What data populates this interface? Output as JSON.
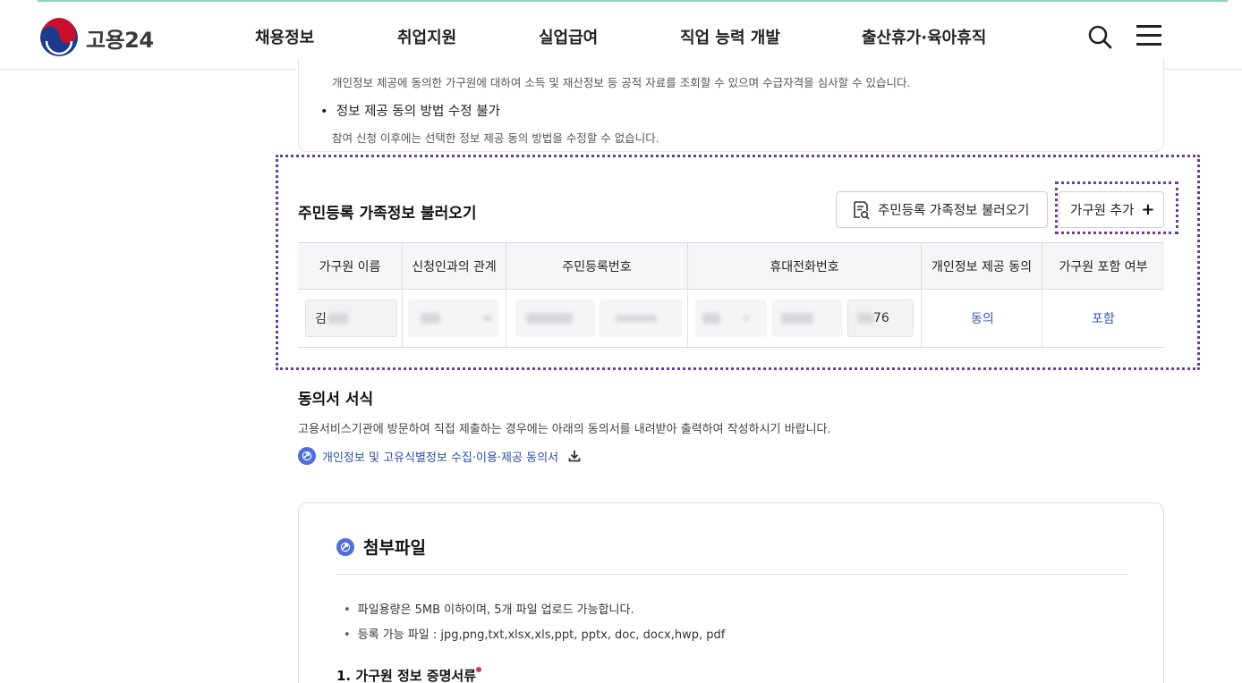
{
  "header": {
    "logo_text": "고용24",
    "nav": [
      "채용정보",
      "취업지원",
      "실업급여",
      "직업 능력 개발",
      "출산휴가·육아휴직"
    ],
    "icons": {
      "search": "search-icon",
      "menu": "hamburger-menu-icon"
    }
  },
  "notice": {
    "line1": "개인정보 제공에 동의한 가구원에 대하여 소득 및 재산정보 등 공적 자료를 조회할 수 있으며 수급자격을 심사할 수 있습니다.",
    "bullet2_title": "정보 제공 동의 방법 수정 불가",
    "bullet2_desc": "참여 신청 이후에는 선택한 정보 제공 동의 방법을 수정할 수 없습니다."
  },
  "family": {
    "title": "주민등록 가족정보 불러오기",
    "load_button": "주민등록 가족정보 불러오기",
    "add_button": "가구원 추가",
    "add_icon": "+",
    "columns": [
      "가구원 이름",
      "신청인과의 관계",
      "주민등록번호",
      "휴대전화번호",
      "개인정보 제공 동의",
      "가구원 포함 여부"
    ],
    "row": {
      "name_prefix": "김",
      "phone_suffix": "76",
      "consent": "동의",
      "include": "포함"
    }
  },
  "consent_form": {
    "title": "동의서 서식",
    "desc": "고용서비스기관에 방문하여 직접 제출하는 경우에는 아래의 동의서를 내려받아 출력하여 작성하시기 바랍니다.",
    "download_link": "개인정보 및 고유식별정보 수집·이용·제공 동의서"
  },
  "attachments": {
    "title": "첨부파일",
    "rules": [
      "파일용량은 5MB 이하이며, 5개 파일 업로드 가능합니다.",
      "등록 가능 파일 : jpg,png,txt,xlsx,xls,ppt, pptx, doc, docx,hwp, pdf"
    ],
    "section1": "1. 가구원 정보 증명서류"
  },
  "colors": {
    "highlight_dotted": "#6a3d9a",
    "link_blue": "#3b57b0",
    "brand_red": "#c8102e",
    "brand_blue": "#1d3b8b",
    "required_dot": "#d6336c"
  }
}
